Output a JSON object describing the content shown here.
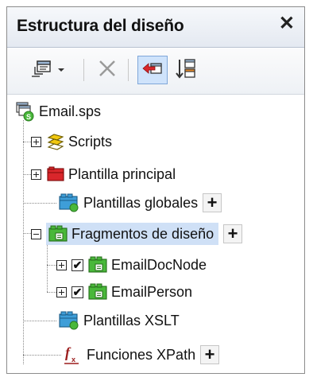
{
  "panel": {
    "title": "Estructura del diseño",
    "close_label": "✕"
  },
  "toolbar": {
    "buttons": [
      {
        "name": "add-template-dropdown",
        "icon": "new-template-icon"
      },
      {
        "name": "remove",
        "icon": "delete-x-icon"
      },
      {
        "name": "show-only-global",
        "icon": "arrow-left-icon"
      },
      {
        "name": "sort",
        "icon": "sort-icon"
      }
    ]
  },
  "tree": {
    "root": {
      "label": "Email.sps",
      "icon": "sps-file-icon"
    },
    "items": [
      {
        "label": "Scripts",
        "icon": "scripts-icon",
        "expand": "plus"
      },
      {
        "label": "Plantilla principal",
        "icon": "main-template-icon",
        "expand": "plus"
      },
      {
        "label": "Plantillas globales",
        "icon": "global-templates-icon",
        "add": "+"
      },
      {
        "label": "Fragmentos de diseño",
        "icon": "design-fragments-icon",
        "expand": "minus",
        "add": "+",
        "selected": true,
        "children": [
          {
            "label": "EmailDocNode",
            "icon": "fragment-icon",
            "expand": "plus",
            "checked": true
          },
          {
            "label": "EmailPerson",
            "icon": "fragment-icon",
            "expand": "plus",
            "checked": true
          }
        ]
      },
      {
        "label": "Plantillas XSLT",
        "icon": "xslt-templates-icon"
      },
      {
        "label": "Funciones XPath",
        "icon": "xpath-functions-icon",
        "add": "+"
      }
    ],
    "check_mark": "✔"
  },
  "colors": {
    "selection": "#cfe0f6",
    "folder_teal": "#3e9ed8",
    "folder_green": "#49b83a",
    "main_red": "#d9262b",
    "scripts_yellow": "#f2c80f"
  }
}
